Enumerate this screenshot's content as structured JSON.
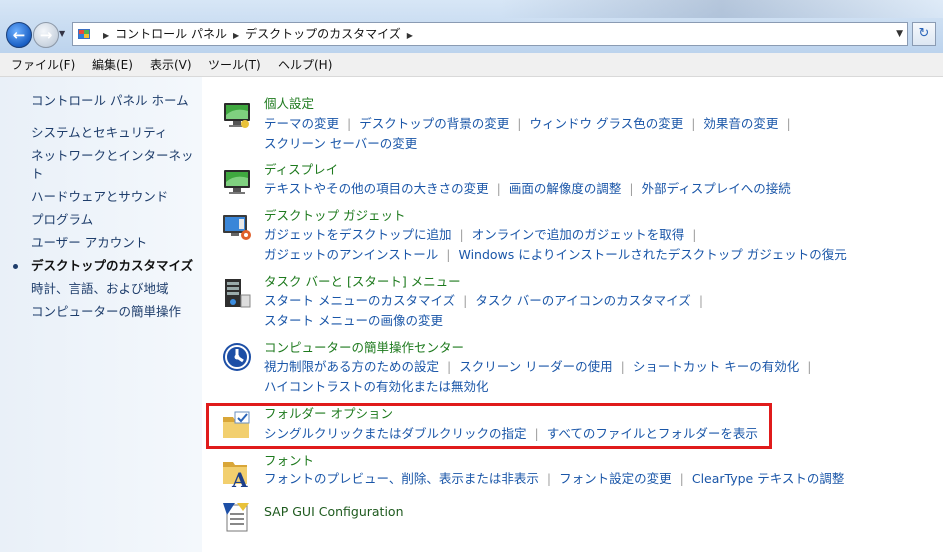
{
  "address": {
    "crumbs": [
      "コントロール パネル",
      "デスクトップのカスタマイズ"
    ]
  },
  "menubar": [
    "ファイル(F)",
    "編集(E)",
    "表示(V)",
    "ツール(T)",
    "ヘルプ(H)"
  ],
  "sidebar": {
    "home": "コントロール パネル ホーム",
    "items": [
      "システムとセキュリティ",
      "ネットワークとインターネット",
      "ハードウェアとサウンド",
      "プログラム",
      "ユーザー アカウント",
      "デスクトップのカスタマイズ",
      "時計、言語、および地域",
      "コンピューターの簡単操作"
    ],
    "network_line1": "ネットワークとインターネッ",
    "network_line2": "ト",
    "current_index": 5
  },
  "categories": [
    {
      "title": "個人設定",
      "icon": "personalization-icon",
      "rows": [
        [
          "テーマの変更",
          "デスクトップの背景の変更",
          "ウィンドウ グラス色の変更",
          "効果音の変更"
        ],
        [
          "スクリーン セーバーの変更"
        ]
      ]
    },
    {
      "title": "ディスプレイ",
      "icon": "display-icon",
      "rows": [
        [
          "テキストやその他の項目の大きさの変更",
          "画面の解像度の調整",
          "外部ディスプレイへの接続"
        ]
      ]
    },
    {
      "title": "デスクトップ ガジェット",
      "icon": "gadgets-icon",
      "rows": [
        [
          "ガジェットをデスクトップに追加",
          "オンラインで追加のガジェットを取得"
        ],
        [
          "ガジェットのアンインストール",
          "Windows によりインストールされたデスクトップ ガジェットの復元"
        ]
      ]
    },
    {
      "title": "タスク バーと [スタート] メニュー",
      "icon": "taskbar-icon",
      "rows": [
        [
          "スタート メニューのカスタマイズ",
          "タスク バーのアイコンのカスタマイズ"
        ],
        [
          "スタート メニューの画像の変更"
        ]
      ]
    },
    {
      "title": "コンピューターの簡単操作センター",
      "icon": "ease-of-access-icon",
      "rows": [
        [
          "視力制限がある方のための設定",
          "スクリーン リーダーの使用",
          "ショートカット キーの有効化"
        ],
        [
          "ハイコントラストの有効化または無効化"
        ]
      ]
    },
    {
      "title": "フォルダー オプション",
      "icon": "folder-options-icon",
      "rows": [
        [
          "シングルクリックまたはダブルクリックの指定",
          "すべてのファイルとフォルダーを表示"
        ]
      ]
    },
    {
      "title": "フォント",
      "icon": "fonts-icon",
      "rows": [
        [
          "フォントのプレビュー、削除、表示または非表示",
          "フォント設定の変更",
          "ClearType テキストの調整"
        ]
      ]
    },
    {
      "title": "SAP GUI Configuration",
      "icon": "sap-gui-icon",
      "rows": []
    }
  ],
  "colors": {
    "highlight": "#e01b1b",
    "category_title": "#1e7a1e",
    "link": "#1a56a8"
  }
}
